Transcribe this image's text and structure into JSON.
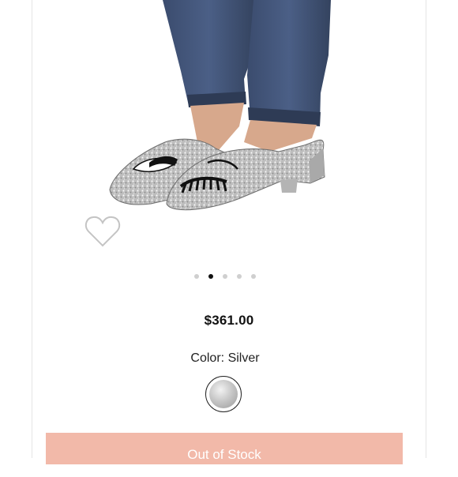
{
  "product": {
    "price": "$361.00",
    "color_label": "Color:",
    "color_value": "Silver",
    "selected_dot_index": 1,
    "dot_count": 5
  },
  "button": {
    "label": "Out of Stock"
  },
  "colors": {
    "button_bg": "#f2b9a9",
    "active_dot": "#111111",
    "inactive_dot": "#cfcfcf"
  },
  "icons": {
    "wishlist": "heart-outline-icon"
  }
}
